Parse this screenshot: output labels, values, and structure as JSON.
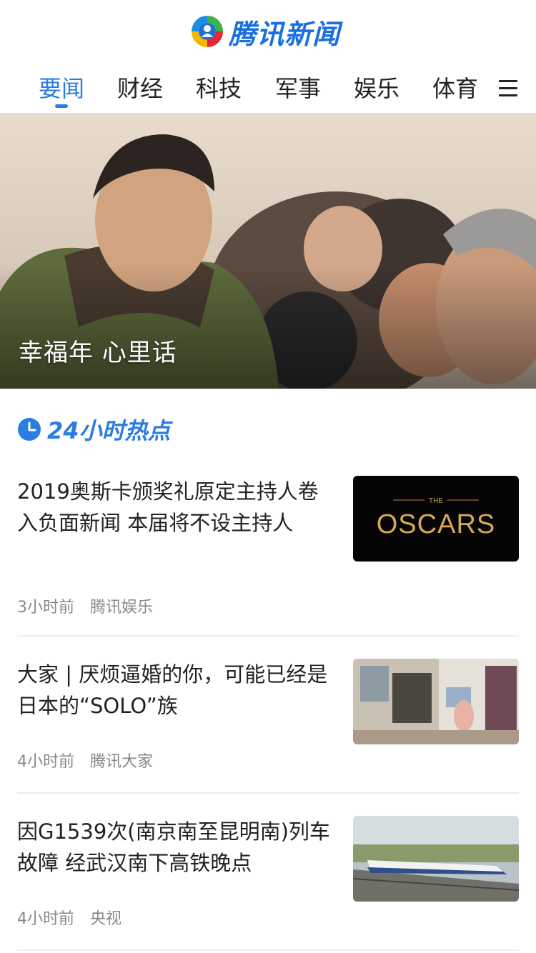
{
  "app": {
    "logo_text": "腾讯新闻"
  },
  "tabs": [
    "要闻",
    "财经",
    "科技",
    "军事",
    "娱乐",
    "体育"
  ],
  "hero": {
    "caption": "幸福年 心里话"
  },
  "section": {
    "title": "24小时热点"
  },
  "news": [
    {
      "title": "2019奥斯卡颁奖礼原定主持人卷入负面新闻 本届将不设主持人",
      "time": "3小时前",
      "source": "腾讯娱乐",
      "thumb_text_top": "THE",
      "thumb_text": "OSCARS"
    },
    {
      "title": "大家 | 厌烦逼婚的你，可能已经是日本的“SOLO”族",
      "time": "4小时前",
      "source": "腾讯大家"
    },
    {
      "title": "因G1539次(南京南至昆明南)列车故障 经武汉南下高铁晚点",
      "time": "4小时前",
      "source": "央视"
    }
  ],
  "colors": {
    "accent": "#2a7de1",
    "logo_blue": "#1a6fe0",
    "meta_gray": "#888888"
  }
}
